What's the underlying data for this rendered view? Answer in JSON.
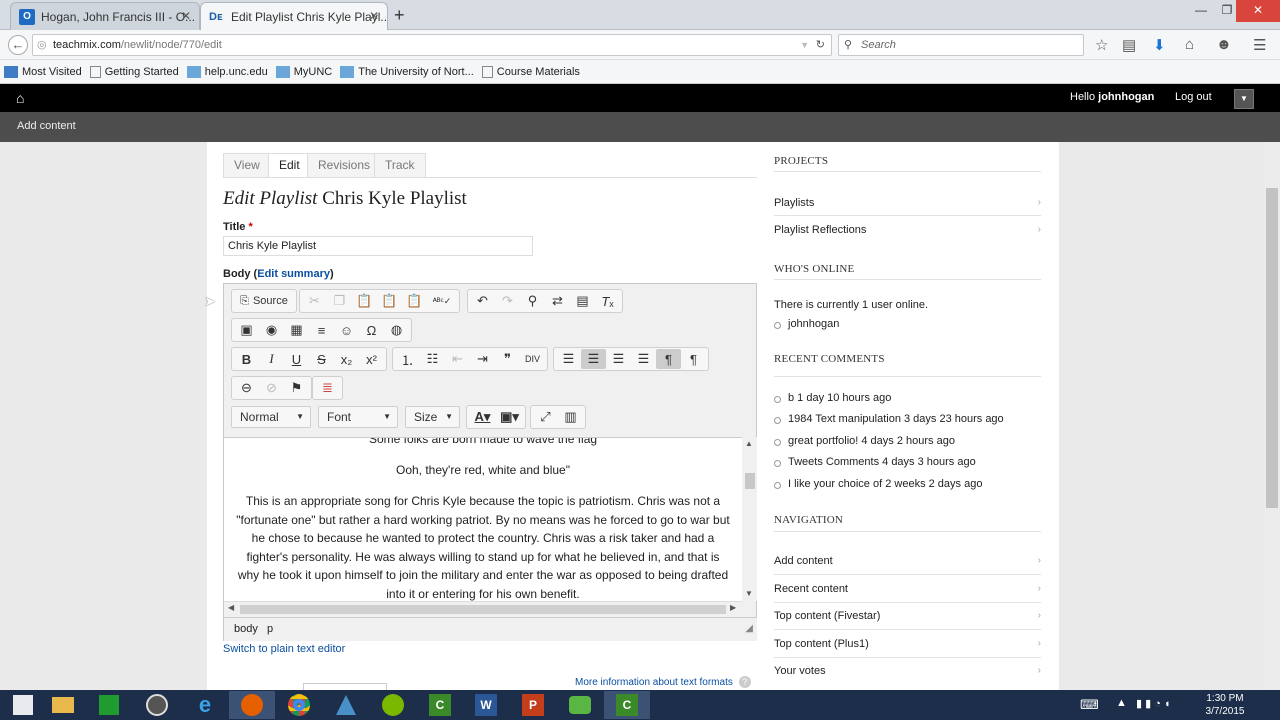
{
  "browser": {
    "tabs": [
      {
        "title": "Hogan, John Francis III - O...",
        "favicon": "outlook",
        "active": false
      },
      {
        "title": "Edit Playlist Chris Kyle Playl...",
        "favicon": "drupal",
        "active": true
      }
    ],
    "url": {
      "host": "teachmix.com",
      "path": "/newlit/node/770/edit"
    },
    "search_placeholder": "Search",
    "bookmarks": [
      "Most Visited",
      "Getting Started",
      "help.unc.edu",
      "MyUNC",
      "The University of Nort...",
      "Course Materials"
    ]
  },
  "drupal": {
    "greeting": "Hello",
    "username": "johnhogan",
    "logout": "Log out",
    "shortcut": "Add content"
  },
  "page": {
    "tabs": [
      "View",
      "Edit",
      "Revisions",
      "Track"
    ],
    "title_italic": "Edit Playlist",
    "title_rest": "Chris Kyle Playlist",
    "title_label": "Title",
    "required_mark": "*",
    "title_value": "Chris Kyle Playlist",
    "body_label": "Body",
    "edit_summary": "Edit summary",
    "editor": {
      "source_label": "Source",
      "format_combo": "Normal",
      "font_combo": "Font",
      "size_combo": "Size",
      "content_line1": "Some folks are born made to wave the flag",
      "content_line2": "Ooh, they're red, white and blue\"",
      "paragraph": "This is an appropriate song for Chris Kyle because the topic is patriotism. Chris was not a \"fortunate one\" but rather a hard working patriot. By no means was he forced to go to war but he chose to because he wanted to protect the country. Chris was a risk taker and had a fighter's personality. He was always willing to stand up for what he believed in, and that is why he took it upon himself to join the military and enter the war as opposed to being drafted into it or entering for his own benefit.",
      "path": [
        "body",
        "p"
      ]
    },
    "switch_plain": "Switch to plain text editor",
    "more_info": "More information about text formats"
  },
  "sidebar": {
    "projects_title": "PROJECTS",
    "projects": [
      "Playlists",
      "Playlist Reflections"
    ],
    "online_title": "WHO'S ONLINE",
    "online_text": "There is currently 1 user online.",
    "online_users": [
      "johnhogan"
    ],
    "comments_title": "RECENT COMMENTS",
    "comments": [
      "b 1 day 10 hours ago",
      "1984 Text manipulation 3 days 23 hours ago",
      "great portfolio! 4 days 2 hours ago",
      "Tweets Comments  4 days 3 hours ago",
      "I like your choice of 2 weeks 2 days ago"
    ],
    "nav_title": "NAVIGATION",
    "nav": [
      "Add content",
      "Recent content",
      "Top content (Fivestar)",
      "Top content (Plus1)",
      "Your votes"
    ]
  },
  "taskbar": {
    "time": "1:30 PM",
    "date": "3/7/2015"
  },
  "colors": {
    "accent_link": "#0a4fa0",
    "toolbar_black": "#000000",
    "shortcut_bar": "#4d4d4d",
    "taskbar": "#1c2e4a"
  }
}
